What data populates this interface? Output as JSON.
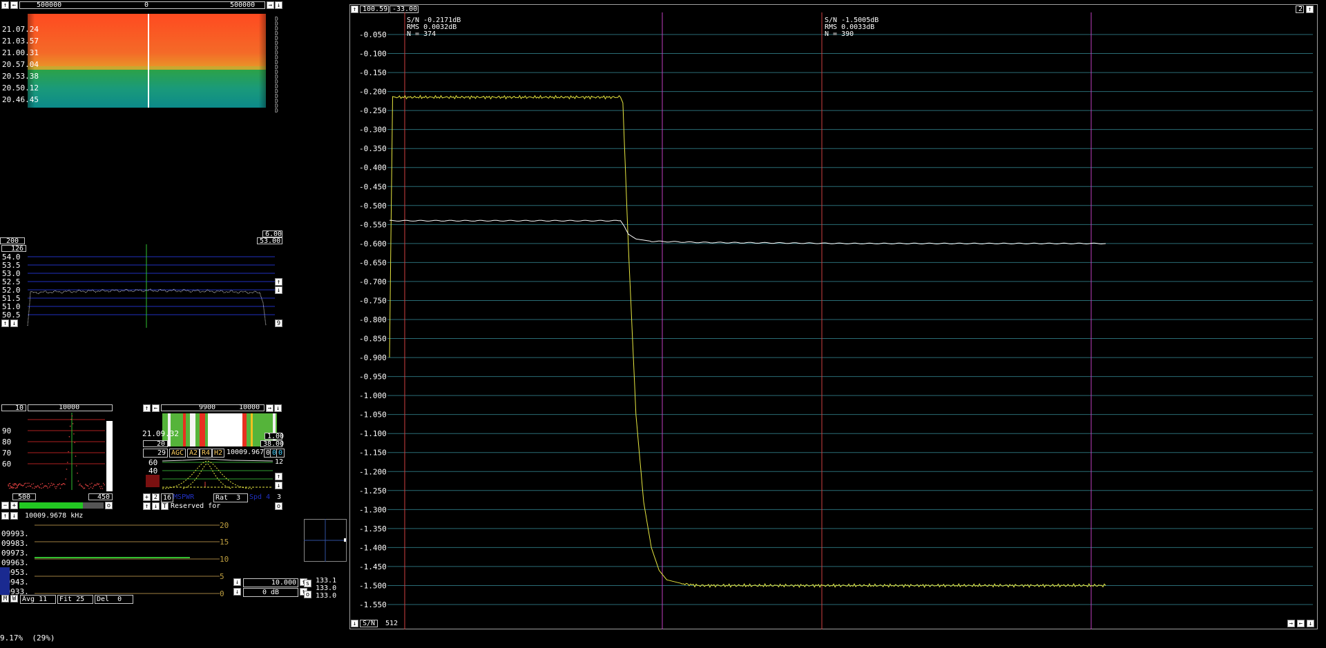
{
  "waterfall": {
    "freq_left": "500000",
    "freq_center": "0",
    "freq_right": "500000",
    "times": [
      "21.07.24",
      "21.03.57",
      "21.00.31",
      "20.57.04",
      "20.53.38",
      "20.50.12",
      "20.46.45"
    ],
    "right_markers": [
      "D",
      "D",
      "D",
      "D",
      "D",
      "D",
      "D",
      "D",
      "D",
      "D",
      "D",
      "D",
      "D",
      "D",
      "D",
      "D",
      "D",
      "D",
      "D",
      "D"
    ],
    "box_top": "6.00",
    "box_bottom": "53.00",
    "box_left": "200"
  },
  "spectrum": {
    "top_box": "126",
    "ylabels": [
      "54.0",
      "53.5",
      "53.0",
      "52.5",
      "52.0",
      "51.5",
      "51.0",
      "50.5"
    ],
    "right_num": "9"
  },
  "hires": {
    "left_box": "10",
    "center_freq": "10000",
    "ylabels": [
      "90",
      "80",
      "70",
      "60"
    ],
    "bottom_left": "500",
    "bottom_right": "450",
    "ctrl_o": "o"
  },
  "baseband": {
    "freq_a": "9900",
    "freq_b": "10000",
    "time": "21.09.32",
    "box_r1": "1.00",
    "box_l": "20",
    "box_r2": "38.00",
    "num29": "29",
    "agc": "AGC",
    "a2": "A2",
    "r4": "R4",
    "h2": "H2",
    "freq": "10009.967",
    "zero": "0",
    "zero_b": "0",
    "zero_c": "0",
    "right12": "12",
    "ylabels": [
      "60",
      "40",
      "20"
    ],
    "row_2": "2",
    "row_16": "16",
    "rat": "Rat  3",
    "row_3": "3",
    "reserved": "Reserved for",
    "o": "o"
  },
  "meter": {
    "freq_label": "10009.9678 kHz",
    "rows": [
      "09993.",
      "09983.",
      "09973.",
      "09963.",
      "09953.",
      "09943.",
      "09933."
    ],
    "scale": [
      "20",
      "15",
      "10",
      "5",
      "0"
    ],
    "m": "M",
    "w": "W",
    "avg": "Avg 11",
    "fit": "Fit 25",
    "del": "Del  0"
  },
  "small_ctrl": {
    "val1": "10.000",
    "val2": "0 dB",
    "s": "s",
    "o": "o",
    "n1": "133.1",
    "n2": "133.0",
    "n3": "133.0"
  },
  "main_chart": {
    "box_left": "100.59",
    "box_right": "-33.00",
    "corner_num": "2",
    "left_stats": {
      "sn": "S/N -0.2171dB",
      "rms": "RMS 0.0032dB",
      "n": "N = 374"
    },
    "right_stats": {
      "sn": "S/N -1.5005dB",
      "rms": "RMS 0.0033dB",
      "n": "N = 390"
    },
    "bottom_label": "S/N",
    "bottom_num": "512"
  },
  "status": "9.17%  (29%)",
  "chart_data": {
    "type": "line",
    "ylim": [
      -1.57,
      -0.02
    ],
    "yticks": [
      "-0.050",
      "-0.100",
      "-0.150",
      "-0.200",
      "-0.250",
      "-0.300",
      "-0.350",
      "-0.400",
      "-0.450",
      "-0.500",
      "-0.550",
      "-0.600",
      "-0.650",
      "-0.700",
      "-0.750",
      "-0.800",
      "-0.850",
      "-0.900",
      "-0.950",
      "-1.000",
      "-1.050",
      "-1.100",
      "-1.150",
      "-1.200",
      "-1.250",
      "-1.300",
      "-1.350",
      "-1.400",
      "-1.450",
      "-1.500",
      "-1.550"
    ],
    "xlim": [
      0,
      1
    ],
    "series": [
      {
        "color": "#e8e840",
        "x": [
          0,
          0.004,
          0.3,
          0.303,
          0.31,
          0.32,
          0.33,
          0.34,
          0.35,
          0.36,
          0.38,
          0.4,
          0.45,
          0.6,
          0.8,
          0.93
        ],
        "values": [
          -0.9,
          -0.215,
          -0.215,
          -0.23,
          -0.6,
          -1.05,
          -1.28,
          -1.4,
          -1.46,
          -1.485,
          -1.495,
          -1.5,
          -1.5,
          -1.5,
          -1.5,
          -1.5
        ]
      },
      {
        "color": "#ffffff",
        "x": [
          0,
          0.3,
          0.305,
          0.31,
          0.32,
          0.34,
          0.4,
          0.6,
          0.8,
          0.93
        ],
        "values": [
          -0.54,
          -0.54,
          -0.555,
          -0.575,
          -0.588,
          -0.594,
          -0.597,
          -0.6,
          -0.6,
          -0.6
        ]
      }
    ]
  },
  "colors": {
    "grid": "#2a6d76",
    "yellow": "#e8e840",
    "magenta": "#c040c0",
    "red": "#d04040"
  }
}
